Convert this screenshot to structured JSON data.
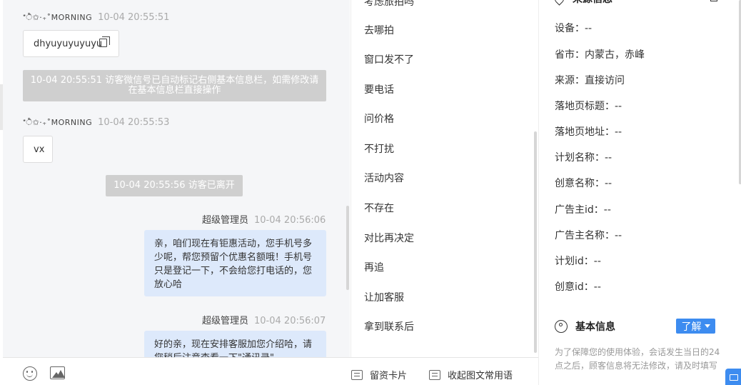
{
  "chat": {
    "messages": [
      {
        "name": "*ੈ✩‧₊˚MORNING",
        "time": "10-04 20:55:51",
        "text": "dhyuyuyuyuyu"
      },
      {
        "system": "10-04 20:55:51 访客微信号已自动标记右侧基本信息栏，如需修改请在基本信息栏直接操作"
      },
      {
        "name": "*ੈ✩‧₊˚MORNING",
        "time": "10-04 20:55:53",
        "text": "vx"
      },
      {
        "system": "10-04 20:55:56 访客已离开"
      },
      {
        "name": "超级管理员",
        "time": "10-04 20:56:06",
        "text": "亲，咱们现在有钜惠活动，您手机号多少呢，帮您预留个优惠名额哦！手机号只是登记一下，不会给您打电话的，您放心哈"
      },
      {
        "name": "超级管理员",
        "time": "10-04 20:56:07",
        "text": "好的亲，现在安排客服加您介绍哈，请您稍后注意查看一下\"通讯录\""
      }
    ]
  },
  "phrases": {
    "items": [
      "考虑旅拍吗",
      "去哪拍",
      "窗口发不了",
      "要电话",
      "问价格",
      "不打扰",
      "活动内容",
      "不存在",
      "对比再决定",
      "再追",
      "让加客服",
      "拿到联系后"
    ]
  },
  "toolbar": {
    "emoji_icon": "smile-icon",
    "image_icon": "image-icon",
    "card_label": "留资卡片",
    "collapse_label": "收起图文常用语"
  },
  "info": {
    "source_title": "来源信息",
    "fields": [
      {
        "label": "设备：",
        "value": "--"
      },
      {
        "label": "省市：",
        "value": "内蒙古，赤峰"
      },
      {
        "label": "来源：",
        "value": "直接访问"
      },
      {
        "label": "落地页标题：",
        "value": "--"
      },
      {
        "label": "落地页地址：",
        "value": "--"
      },
      {
        "label": "计划名称：",
        "value": "--"
      },
      {
        "label": "创意名称：",
        "value": "--"
      },
      {
        "label": "广告主id：",
        "value": "--"
      },
      {
        "label": "广告主名称：",
        "value": "--"
      },
      {
        "label": "计划id：",
        "value": "--"
      },
      {
        "label": "创意id：",
        "value": "--"
      }
    ],
    "basic_title": "基本信息",
    "learn_label": "了解",
    "note": "为了保障您的使用体验，会话发生当日的24点之后，顾客信息将无法修改，请及时填写"
  },
  "colors": {
    "accent": "#3d8cf0",
    "bubble_blue": "#dde9fb",
    "system_bar": "#cfcfcf"
  }
}
